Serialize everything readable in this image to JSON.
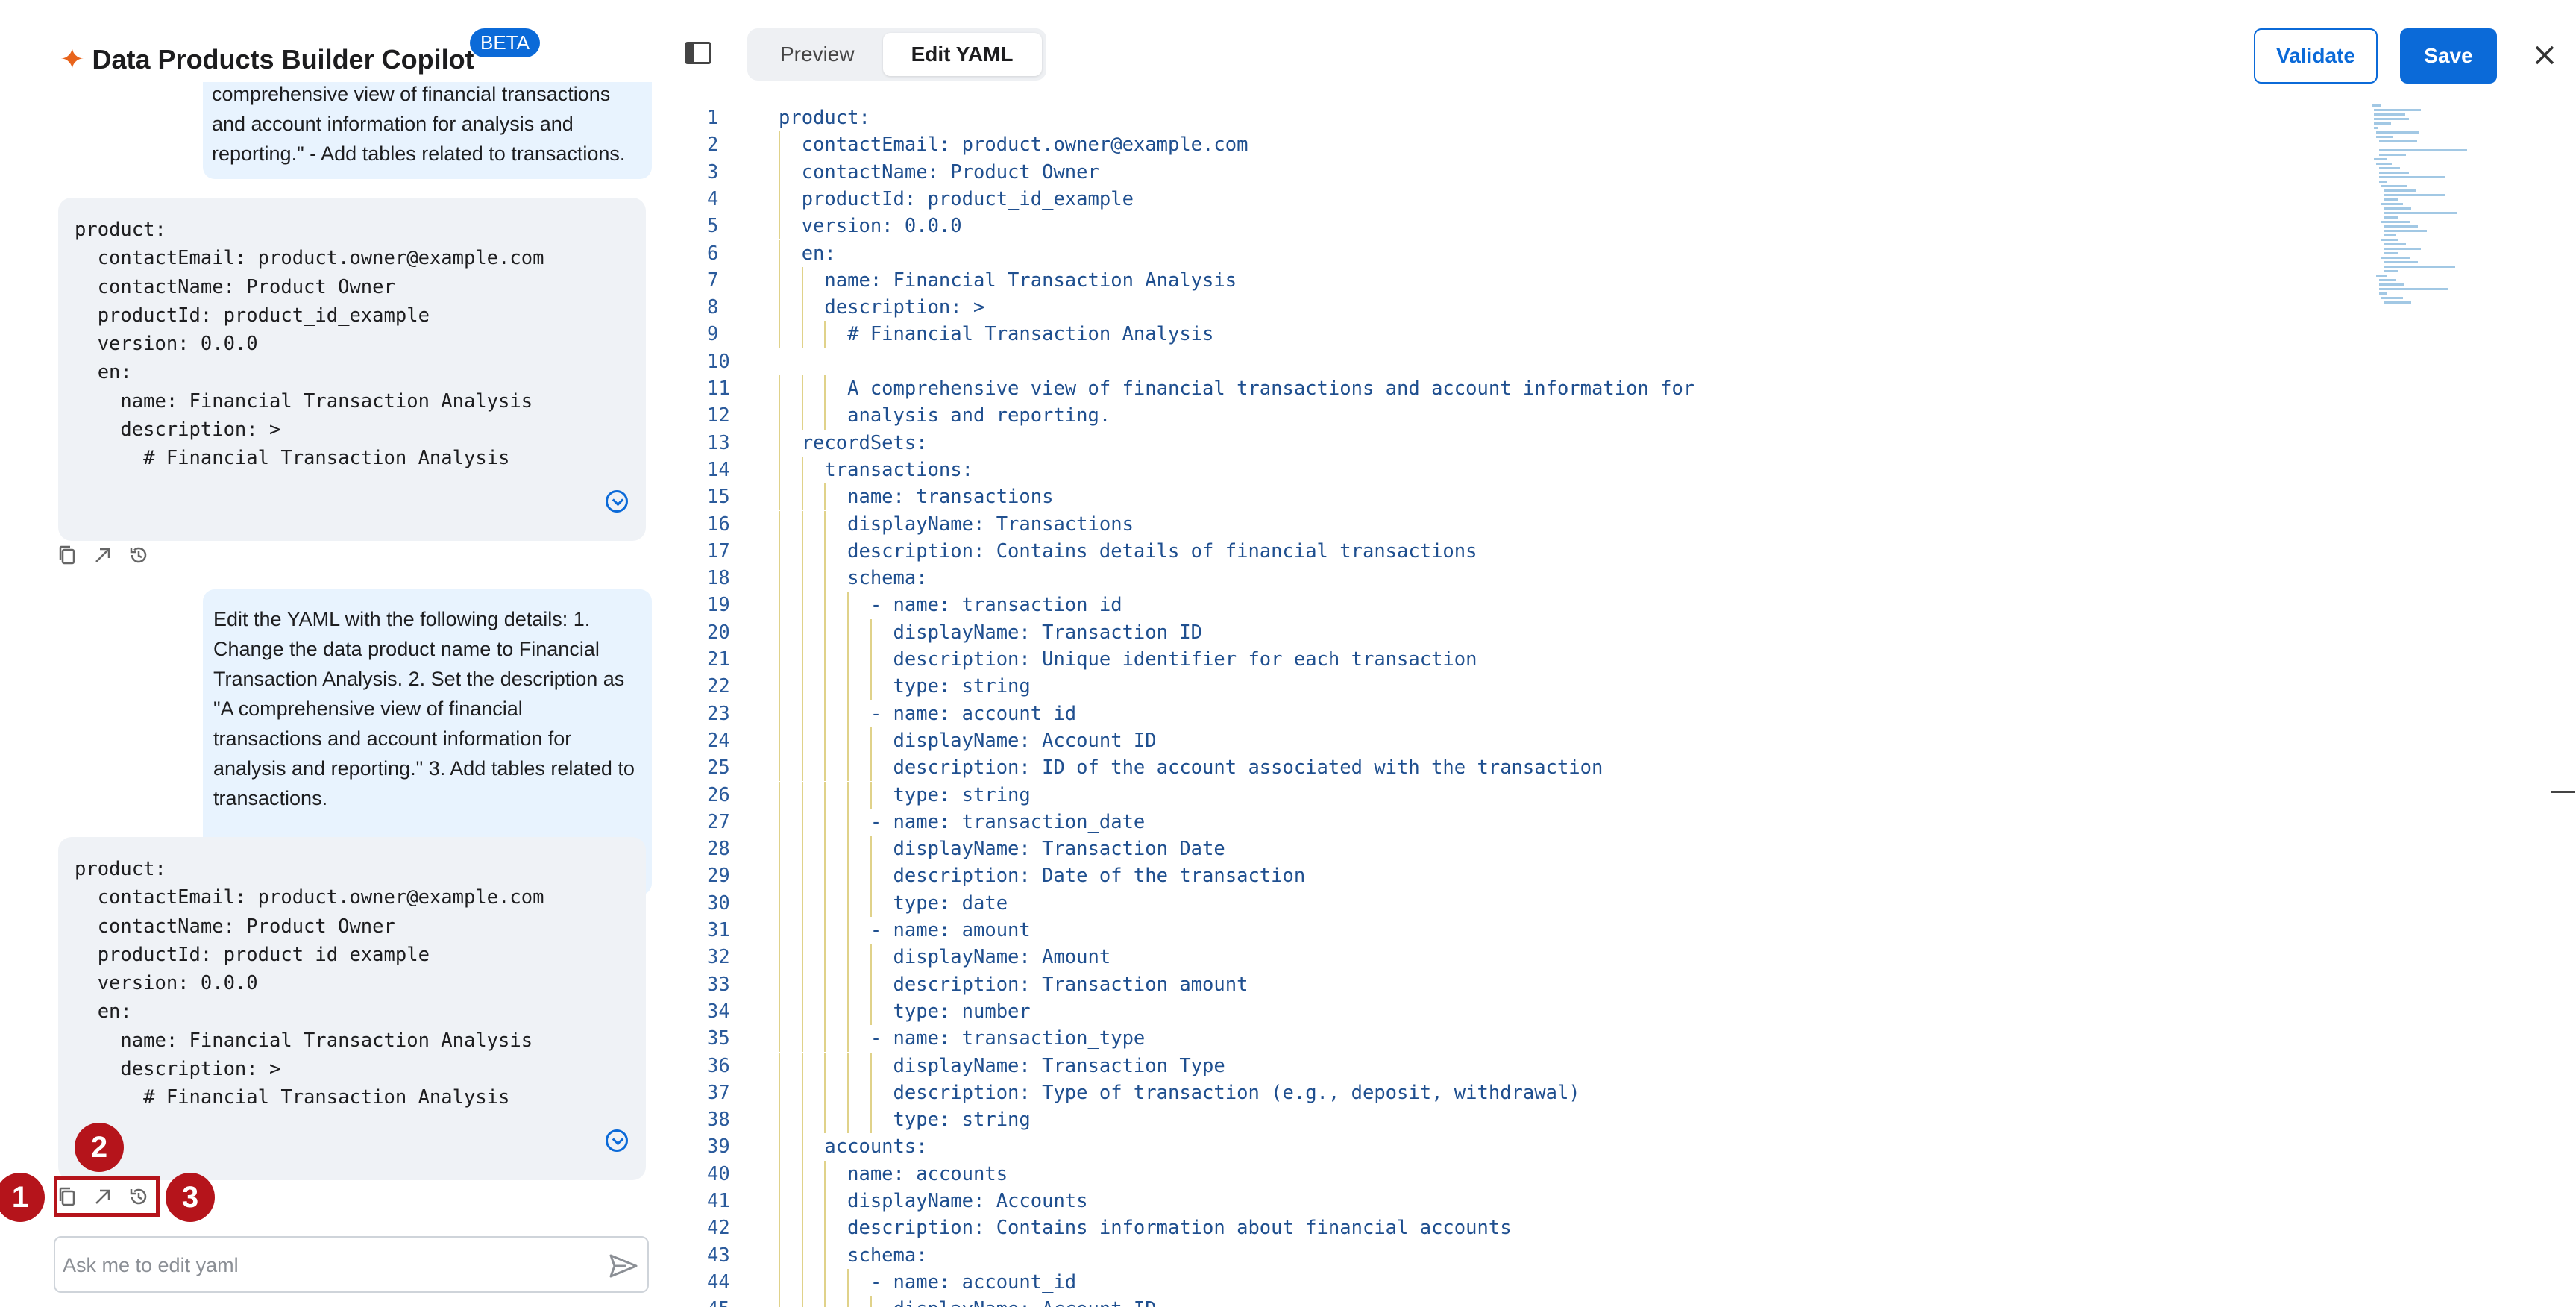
{
  "header": {
    "title": "Data Products Builder Copilot",
    "badge": "BETA"
  },
  "chat": {
    "msg1_user_tail": "comprehensive view of financial transactions and account information for analysis and reporting.\" - Add tables related to transactions.",
    "msg1_code": "product:\n  contactEmail: product.owner@example.com\n  contactName: Product Owner\n  productId: product_id_example\n  version: 0.0.0\n  en:\n    name: Financial Transaction Analysis\n    description: >\n      # Financial Transaction Analysis",
    "msg2_user": "Edit the YAML with the following details: 1. Change the data product name to Financial Transaction Analysis. 2. Set the description as \"A comprehensive view of financial transactions and account information for analysis and reporting.\" 3. Add tables related to transactions.",
    "msg2_code": "product:\n  contactEmail: product.owner@example.com\n  contactName: Product Owner\n  productId: product_id_example\n  version: 0.0.0\n  en:\n    name: Financial Transaction Analysis\n    description: >\n      # Financial Transaction Analysis",
    "input_placeholder": "Ask me to edit yaml"
  },
  "markers": [
    "1",
    "2",
    "3"
  ],
  "toolbar": {
    "tabs": [
      "Preview",
      "Edit YAML"
    ],
    "active_tab": "Edit YAML",
    "validate_label": "Validate",
    "save_label": "Save"
  },
  "editor": {
    "lines": [
      "product:",
      "  contactEmail: product.owner@example.com",
      "  contactName: Product Owner",
      "  productId: product_id_example",
      "  version: 0.0.0",
      "  en:",
      "    name: Financial Transaction Analysis",
      "    description: >",
      "      # Financial Transaction Analysis",
      "",
      "      A comprehensive view of financial transactions and account information for",
      "      analysis and reporting.",
      "  recordSets:",
      "    transactions:",
      "      name: transactions",
      "      displayName: Transactions",
      "      description: Contains details of financial transactions",
      "      schema:",
      "        - name: transaction_id",
      "          displayName: Transaction ID",
      "          description: Unique identifier for each transaction",
      "          type: string",
      "        - name: account_id",
      "          displayName: Account ID",
      "          description: ID of the account associated with the transaction",
      "          type: string",
      "        - name: transaction_date",
      "          displayName: Transaction Date",
      "          description: Date of the transaction",
      "          type: date",
      "        - name: amount",
      "          displayName: Amount",
      "          description: Transaction amount",
      "          type: number",
      "        - name: transaction_type",
      "          displayName: Transaction Type",
      "          description: Type of transaction (e.g., deposit, withdrawal)",
      "          type: string",
      "    accounts:",
      "      name: accounts",
      "      displayName: Accounts",
      "      description: Contains information about financial accounts",
      "      schema:",
      "        - name: account_id",
      "          displayName: Account ID"
    ]
  },
  "colors": {
    "accent": "#0b6ad8",
    "marker": "#b5141b",
    "user_bubble": "#e8f3fe",
    "code_bubble": "#eff2f6"
  }
}
